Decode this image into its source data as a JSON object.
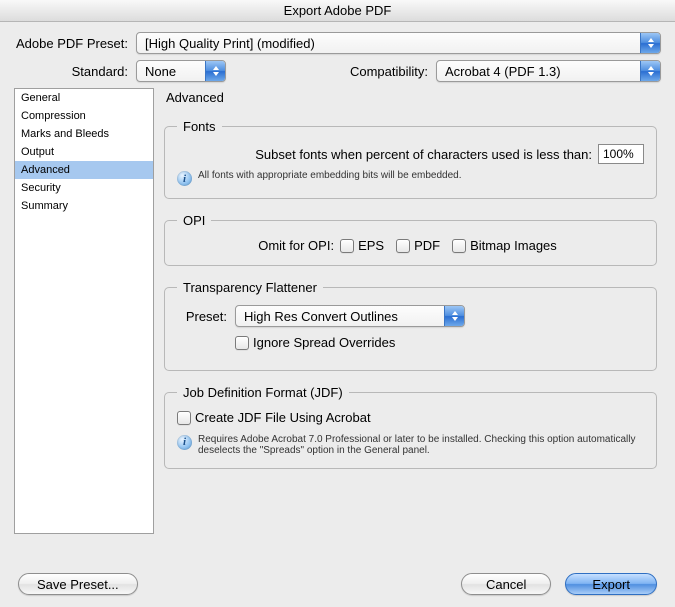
{
  "title": "Export Adobe PDF",
  "preset": {
    "label": "Adobe PDF Preset:",
    "value": "[High Quality Print] (modified)"
  },
  "standard": {
    "label": "Standard:",
    "value": "None"
  },
  "compatibility": {
    "label": "Compatibility:",
    "value": "Acrobat 4 (PDF 1.3)"
  },
  "sidebar": {
    "items": [
      {
        "label": "General"
      },
      {
        "label": "Compression"
      },
      {
        "label": "Marks and Bleeds"
      },
      {
        "label": "Output"
      },
      {
        "label": "Advanced"
      },
      {
        "label": "Security"
      },
      {
        "label": "Summary"
      }
    ],
    "selected": "Advanced"
  },
  "panel": {
    "title": "Advanced"
  },
  "fonts": {
    "legend": "Fonts",
    "subset_label": "Subset fonts when percent of characters used is less than:",
    "subset_value": "100%",
    "info": "All fonts with appropriate embedding bits will be embedded."
  },
  "opi": {
    "legend": "OPI",
    "label": "Omit for OPI:",
    "eps": "EPS",
    "pdf": "PDF",
    "bitmap": "Bitmap Images"
  },
  "flattener": {
    "legend": "Transparency Flattener",
    "preset_label": "Preset:",
    "preset_value": "High Res Convert Outlines",
    "ignore_label": "Ignore Spread Overrides"
  },
  "jdf": {
    "legend": "Job Definition Format (JDF)",
    "create_label": "Create JDF File Using Acrobat",
    "info": "Requires Adobe Acrobat 7.0 Professional or later to be installed. Checking this option automatically deselects the \"Spreads\" option in the General panel."
  },
  "buttons": {
    "save_preset": "Save Preset...",
    "cancel": "Cancel",
    "export": "Export"
  }
}
